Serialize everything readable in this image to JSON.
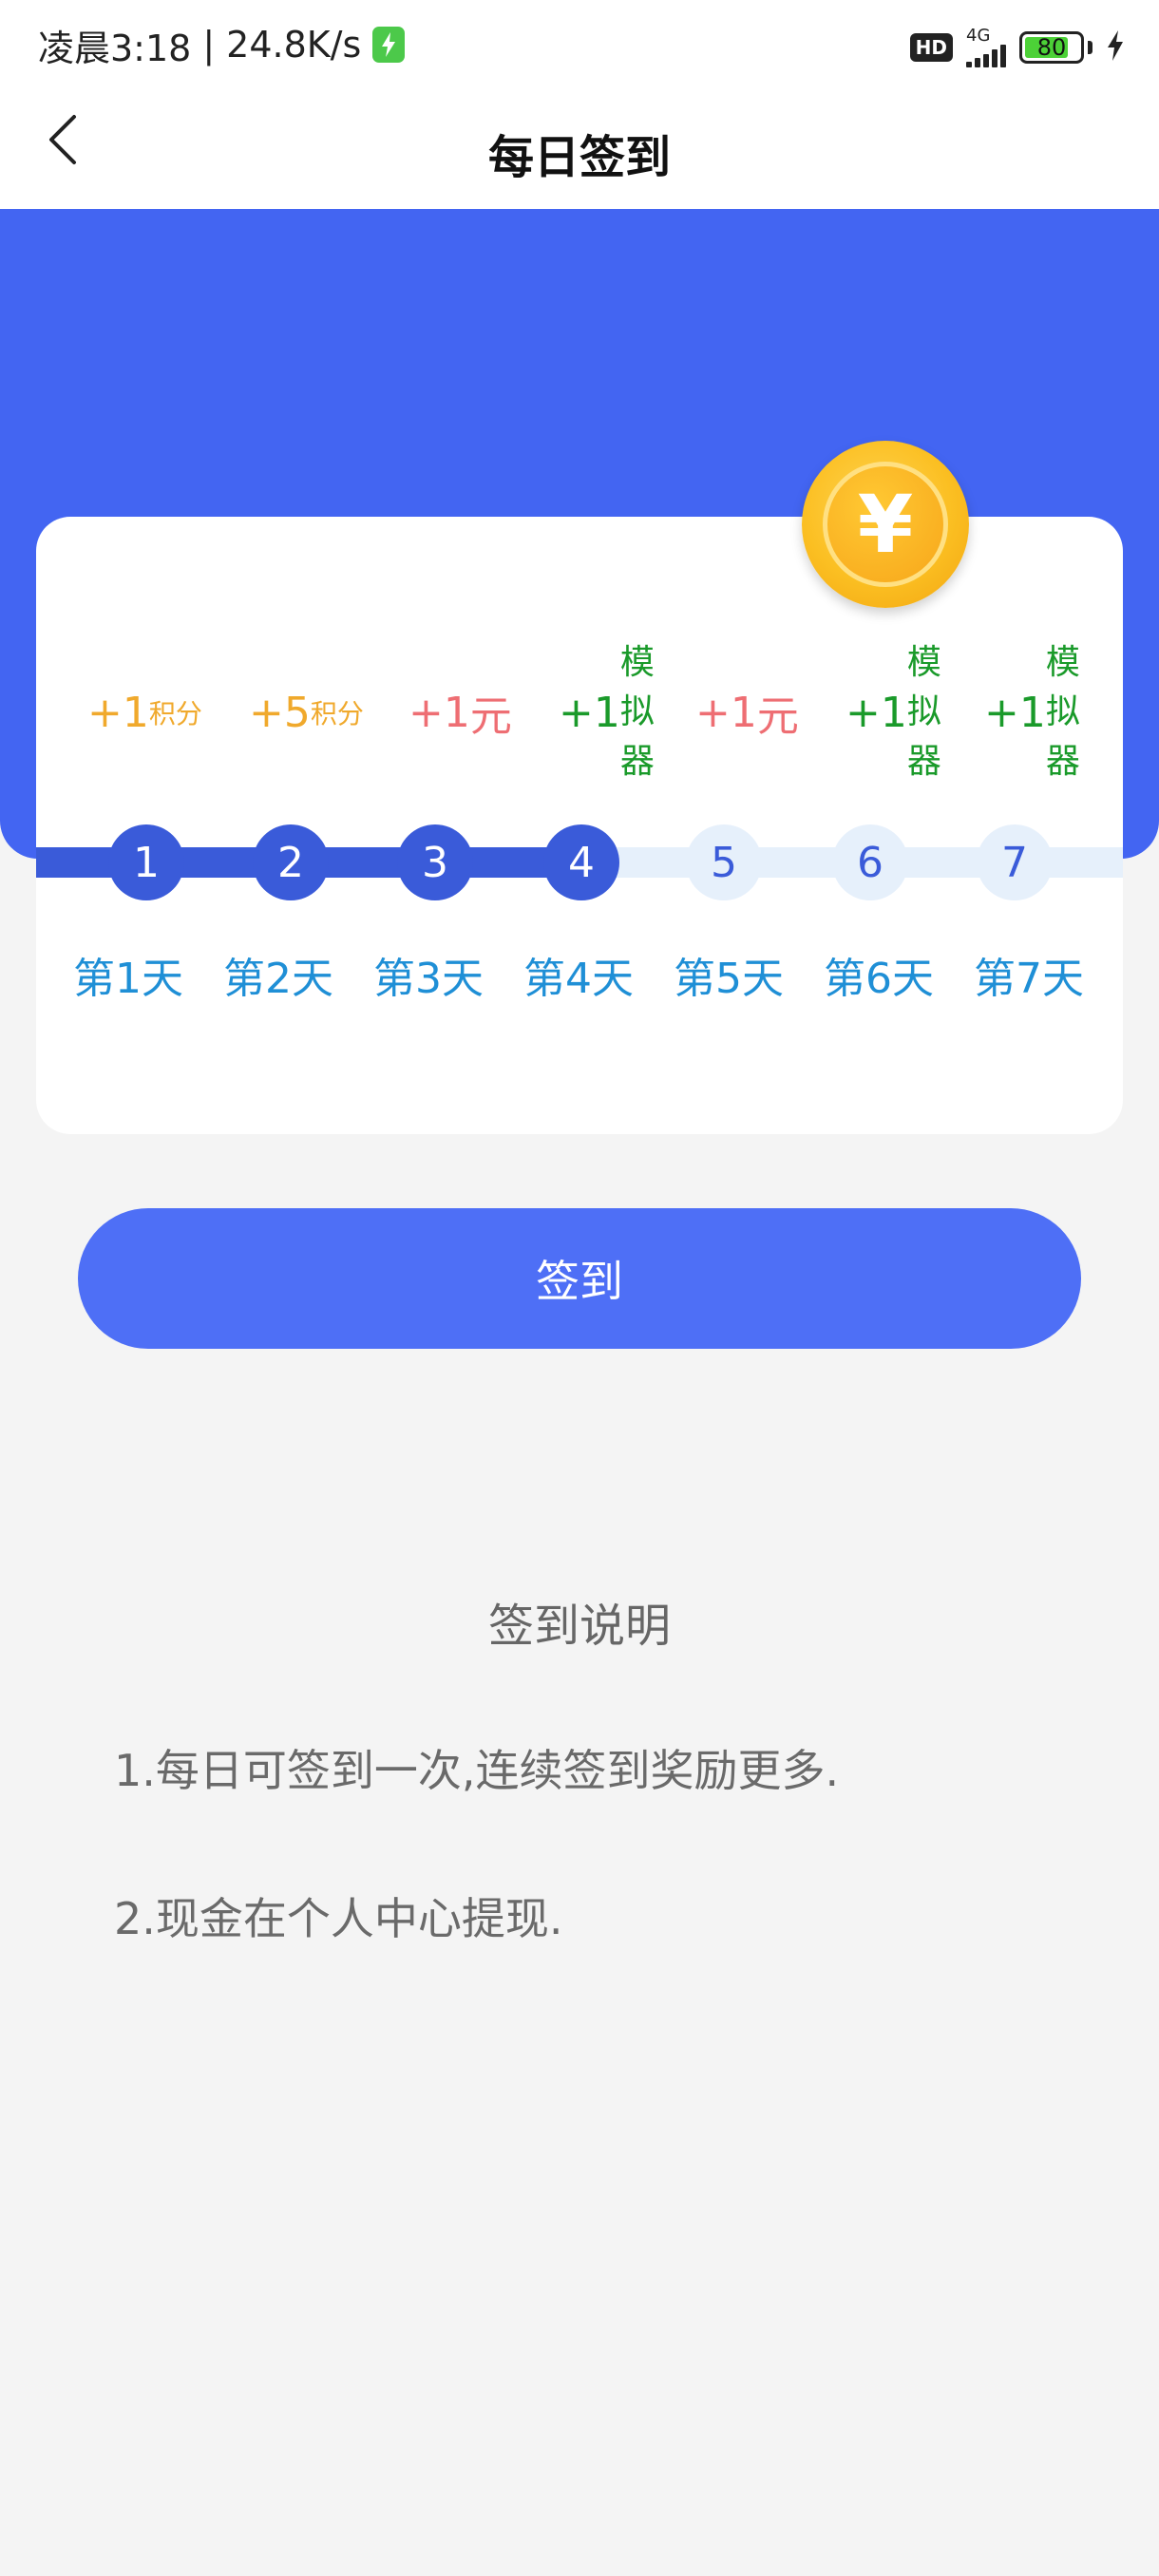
{
  "status_bar": {
    "time": "凌晨3:18",
    "speed": "24.8K/s",
    "hd": "HD",
    "network": "4G",
    "battery": "80"
  },
  "header": {
    "title": "每日签到"
  },
  "rewards": [
    {
      "plus": "+1",
      "unit": "积分",
      "kind": "points"
    },
    {
      "plus": "+5",
      "unit": "积分",
      "kind": "points"
    },
    {
      "plus": "+1",
      "unit": "元",
      "kind": "cash"
    },
    {
      "plus": "+1",
      "unit_chars": [
        "模",
        "拟",
        "器"
      ],
      "kind": "emulator"
    },
    {
      "plus": "+1",
      "unit": "元",
      "kind": "cash"
    },
    {
      "plus": "+1",
      "unit_chars": [
        "模",
        "拟",
        "器"
      ],
      "kind": "emulator"
    },
    {
      "plus": "+1",
      "unit_chars": [
        "模",
        "拟",
        "器"
      ],
      "kind": "emulator"
    }
  ],
  "days": [
    {
      "number": "1",
      "label": "第1天",
      "done": true
    },
    {
      "number": "2",
      "label": "第2天",
      "done": true
    },
    {
      "number": "3",
      "label": "第3天",
      "done": true
    },
    {
      "number": "4",
      "label": "第4天",
      "done": true
    },
    {
      "number": "5",
      "label": "第5天",
      "done": false
    },
    {
      "number": "6",
      "label": "第6天",
      "done": false
    },
    {
      "number": "7",
      "label": "第7天",
      "done": false
    }
  ],
  "coin_symbol": "¥",
  "signin_button": "签到",
  "rules": {
    "title": "签到说明",
    "items": [
      "1.每日可签到一次,连续签到奖励更多.",
      "2.现金在个人中心提现."
    ]
  },
  "colors": {
    "primary": "#4365f2",
    "button": "#4e6ff6",
    "points": "#f0a92c",
    "cash": "#ee6e73",
    "emulator": "#1a9a2a",
    "day_label": "#1f8fd6"
  }
}
